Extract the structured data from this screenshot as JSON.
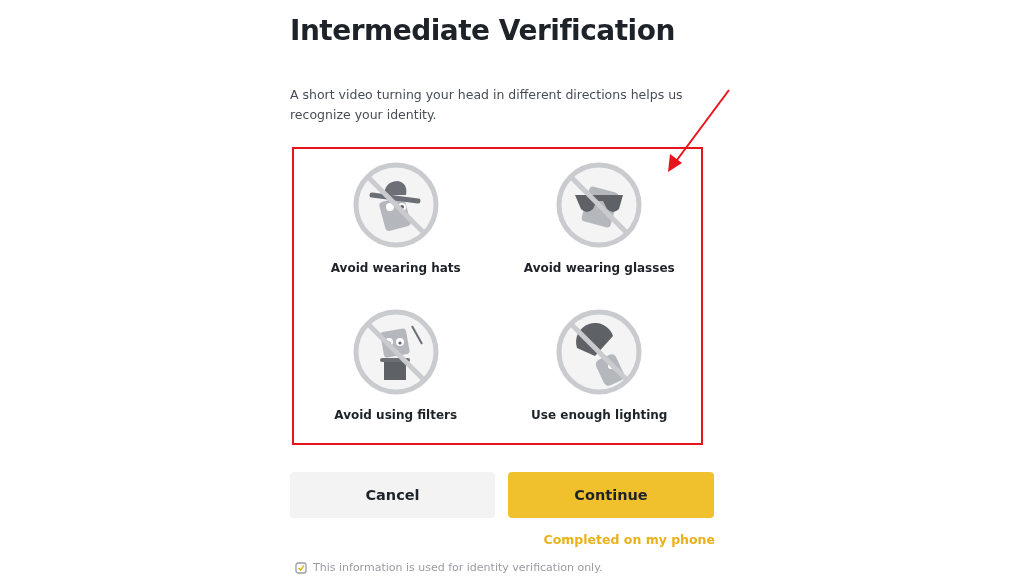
{
  "title": "Intermediate Verification",
  "description": "A short video turning your head in different directions helps us recognize your identity.",
  "tips": {
    "highlighted": true,
    "items": [
      {
        "kind": "hat",
        "label": "Avoid wearing hats"
      },
      {
        "kind": "glasses",
        "label": "Avoid wearing glasses"
      },
      {
        "kind": "filters",
        "label": "Avoid using filters"
      },
      {
        "kind": "lighting",
        "label": "Use enough lighting"
      }
    ]
  },
  "buttons": [
    {
      "kind": "secondary",
      "label": "Cancel"
    },
    {
      "kind": "primary",
      "label": "Continue"
    }
  ],
  "phone_link": "Completed on my phone",
  "note": "This information is used for identity verification only."
}
